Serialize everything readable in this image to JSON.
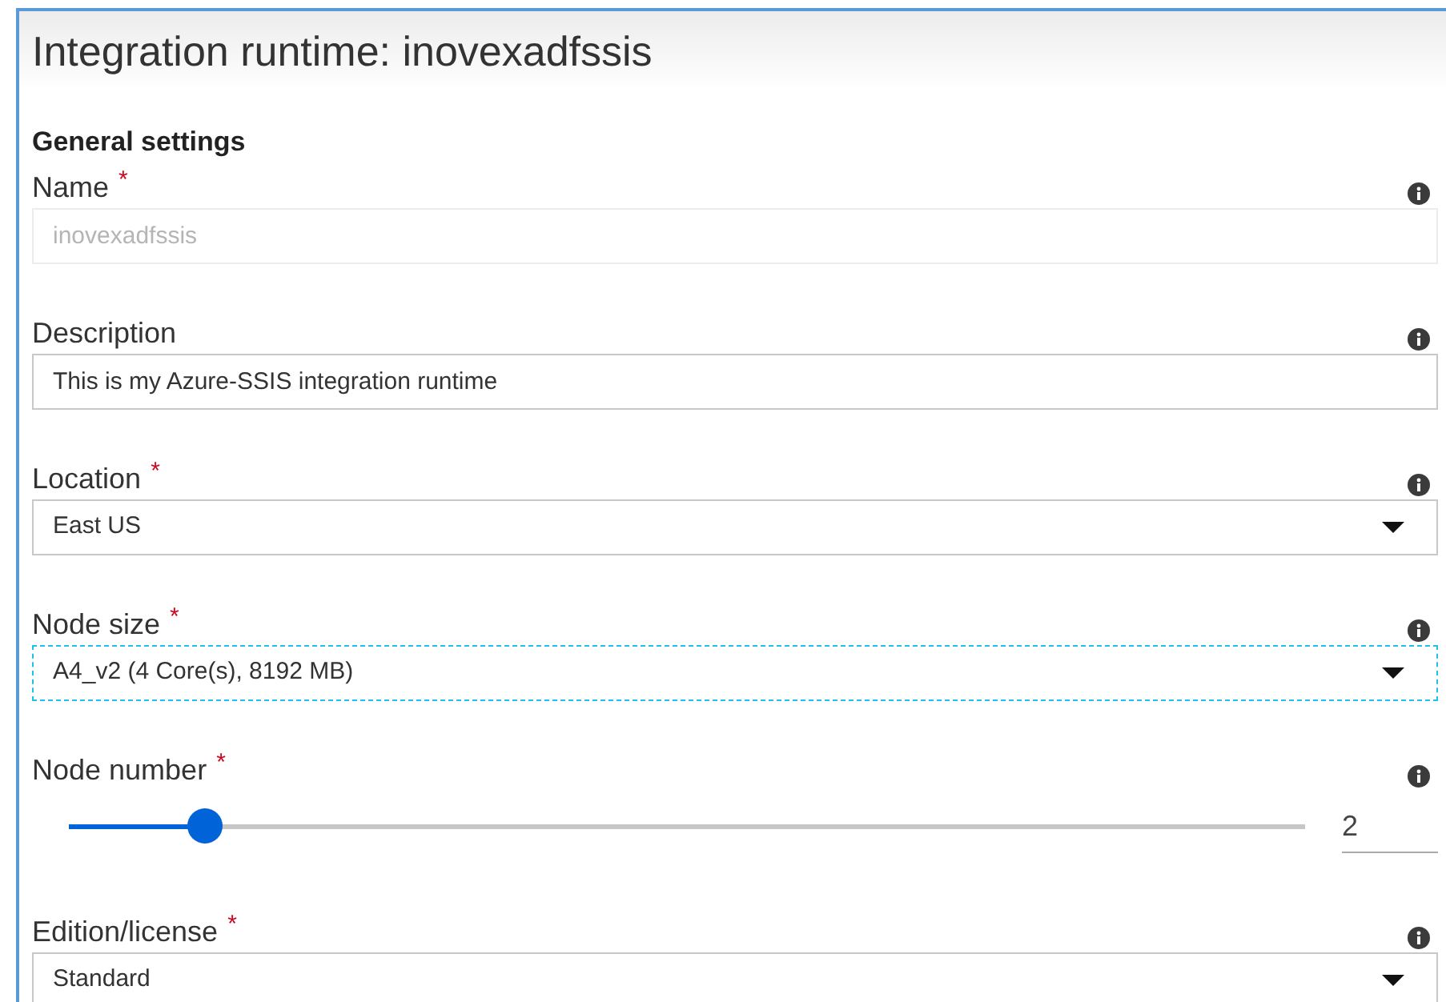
{
  "title": "Integration runtime: inovexadfssis",
  "section": "General settings",
  "fields": [
    {
      "kind": "text",
      "label": "Name",
      "required_mark": "*",
      "value": "inovexadfssis",
      "disabled": true
    },
    {
      "kind": "text",
      "label": "Description",
      "value": "This is my Azure-SSIS integration runtime",
      "disabled": false
    },
    {
      "kind": "dropdown",
      "label": "Location",
      "required_mark": "*",
      "value": "East US",
      "focused": false
    },
    {
      "kind": "dropdown",
      "label": "Node size",
      "required_mark": "*",
      "value": "A4_v2 (4 Core(s), 8192 MB)",
      "focused": true
    },
    {
      "kind": "slider",
      "label": "Node number",
      "required_mark": "*",
      "value": "2",
      "level": 0.11
    },
    {
      "kind": "dropdown",
      "label": "Edition/license",
      "required_mark": "*",
      "value": "Standard",
      "focused": false
    }
  ]
}
